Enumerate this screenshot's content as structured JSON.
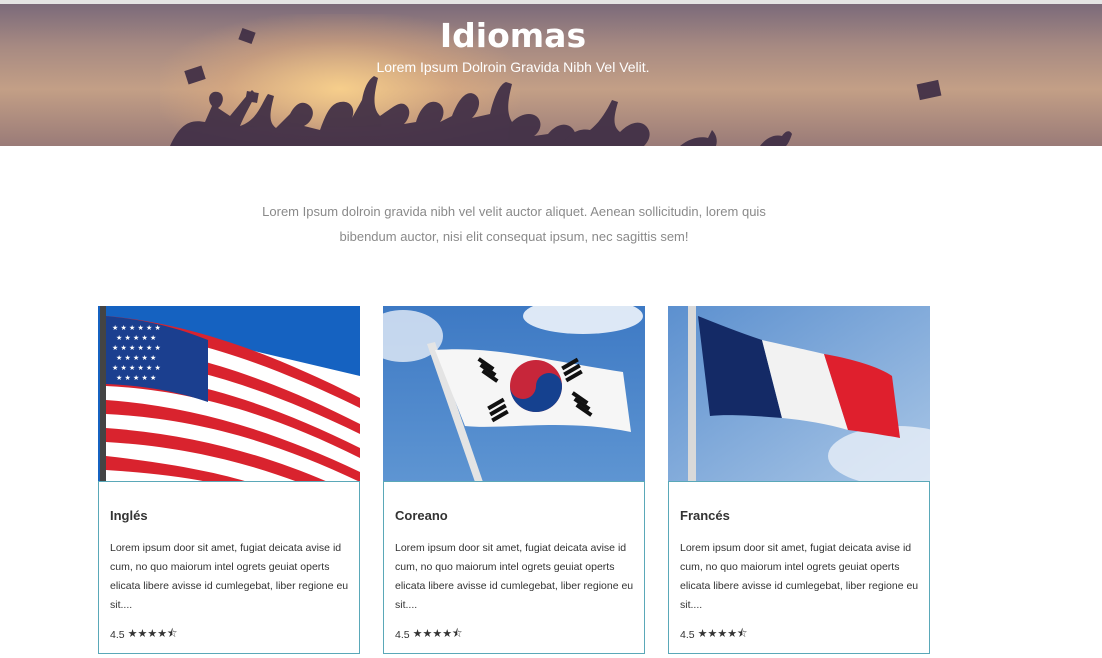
{
  "hero": {
    "title": "Idiomas",
    "subtitle": "Lorem Ipsum Dolroin Gravida Nibh Vel Velit."
  },
  "intro": "Lorem Ipsum dolroin gravida nibh vel velit auctor aliquet. Aenean sollicitudin, lorem quis bibendum auctor, nisi elit consequat ipsum, nec sagittis sem!",
  "courses": [
    {
      "name": "Inglés",
      "flag_icon": "usa-flag",
      "description": "Lorem ipsum door sit amet, fugiat deicata avise id cum, no quo maiorum intel ogrets geuiat operts elicata libere avisse id cumlegebat, liber regione eu sit....",
      "rating": "4.5",
      "stars": "★★★★⯪"
    },
    {
      "name": "Coreano",
      "flag_icon": "south-korea-flag",
      "description": "Lorem ipsum door sit amet, fugiat deicata avise id cum, no quo maiorum intel ogrets geuiat operts elicata libere avisse id cumlegebat, liber regione eu sit....",
      "rating": "4.5",
      "stars": "★★★★⯪"
    },
    {
      "name": "Francés",
      "flag_icon": "france-flag",
      "description": "Lorem ipsum door sit amet, fugiat deicata avise id cum, no quo maiorum intel ogrets geuiat operts elicata libere avisse id cumlegebat, liber regione eu sit....",
      "rating": "4.5",
      "stars": "★★★★⯪"
    }
  ],
  "colors": {
    "card_border": "#5aa8b8",
    "text_dark": "#333333",
    "text_muted": "#8a8a8a"
  }
}
